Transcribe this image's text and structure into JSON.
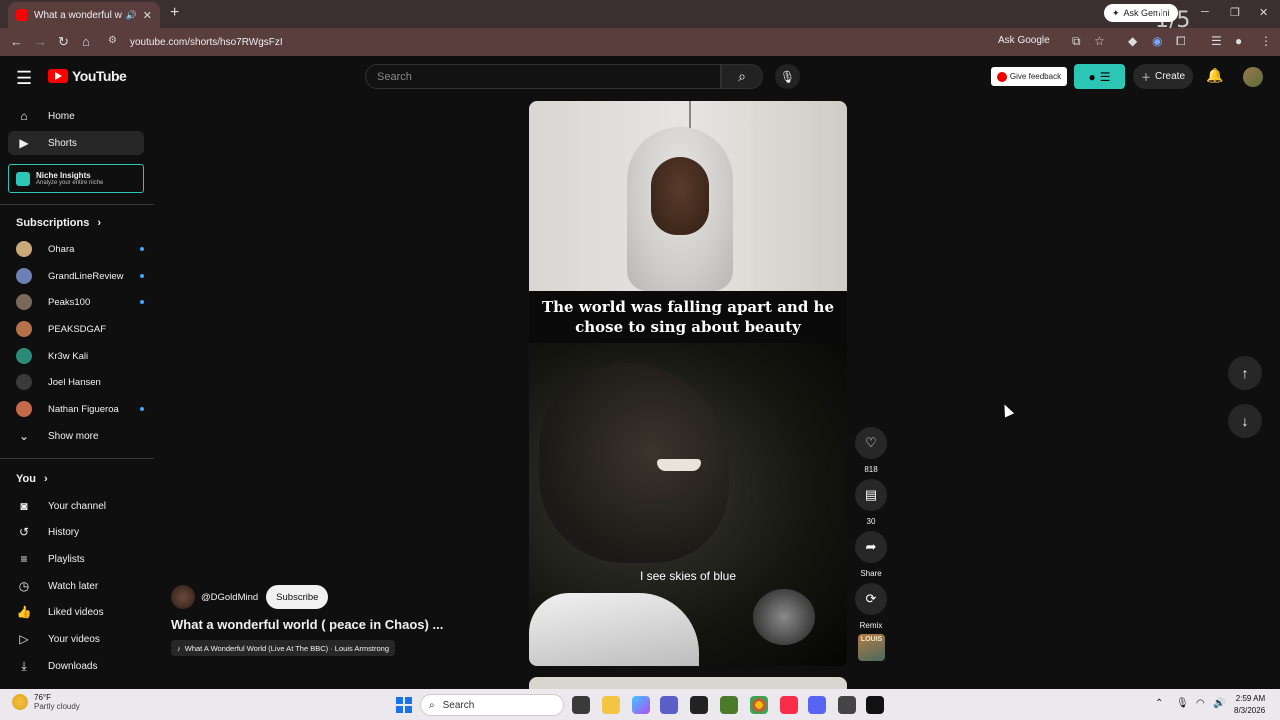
{
  "browser": {
    "tab_title": "What a wonderful world ( p",
    "url": "youtube.com/shorts/hso7RWgsFzI",
    "ask_gemini": "Ask Gemini",
    "ask_google": "Ask Google",
    "page_counter": "1/5"
  },
  "masthead": {
    "logo_text": "YouTube",
    "search_placeholder": "Search",
    "feedback_label": "Give feedback",
    "create_label": "Create"
  },
  "sidebar": {
    "main": [
      {
        "label": "Home",
        "icon": "home-icon"
      },
      {
        "label": "Shorts",
        "icon": "shorts-icon"
      }
    ],
    "niche": {
      "title": "Niche Insights",
      "subtitle": "Analyze your entire niche"
    },
    "subscriptions_heading": "Subscriptions",
    "subscriptions": [
      {
        "name": "Ohara",
        "live": true,
        "color": "#c9a87a"
      },
      {
        "name": "GrandLineReview",
        "live": true,
        "color": "#6d7fb5"
      },
      {
        "name": "Peaks100",
        "live": true,
        "color": "#7a6a5a"
      },
      {
        "name": "PEAKSDGAF",
        "live": false,
        "color": "#b5714a"
      },
      {
        "name": "Kr3w Kali",
        "live": false,
        "color": "#2c8a78"
      },
      {
        "name": "Joel Hansen",
        "live": false,
        "color": "#3a3a3a"
      },
      {
        "name": "Nathan Figueroa",
        "live": true,
        "color": "#c46a4a"
      }
    ],
    "show_more": "Show more",
    "you_heading": "You",
    "you_items": [
      {
        "label": "Your channel",
        "icon": "channel-icon"
      },
      {
        "label": "History",
        "icon": "history-icon"
      },
      {
        "label": "Playlists",
        "icon": "playlists-icon"
      },
      {
        "label": "Watch later",
        "icon": "clock-icon"
      },
      {
        "label": "Liked videos",
        "icon": "thumbs-up-icon"
      },
      {
        "label": "Your videos",
        "icon": "video-icon"
      },
      {
        "label": "Downloads",
        "icon": "download-icon"
      }
    ]
  },
  "short": {
    "caption": "The world was falling apart and he chose to sing about beauty",
    "subtitle": "I see skies of blue",
    "channel": "@DGoldMind",
    "subscribe_label": "Subscribe",
    "title": "What a wonderful world ( peace in Chaos) ...",
    "music": "What A Wonderful World (Live At The BBC) · Louis Armstrong"
  },
  "actions": {
    "likes": "818",
    "comments": "30",
    "share": "Share",
    "remix": "Remix",
    "remix_thumb_text": "LOUIS"
  },
  "taskbar": {
    "temperature": "76°F",
    "condition": "Partly cloudy",
    "search": "Search",
    "time": "2:59 AM",
    "date": "8/3/2026"
  },
  "colors": {
    "background": "#0f0f0f",
    "brand_red": "#ff0000",
    "teal_extension": "#2bc7b4",
    "live_dot": "#3ea6ff"
  }
}
